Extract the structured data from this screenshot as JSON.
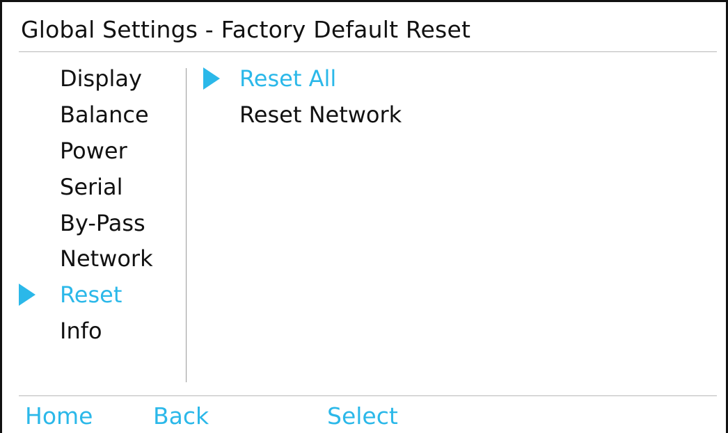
{
  "header": {
    "title": "Global Settings - Factory Default Reset"
  },
  "menu": {
    "items": [
      {
        "label": "Display",
        "selected": false
      },
      {
        "label": "Balance",
        "selected": false
      },
      {
        "label": "Power",
        "selected": false
      },
      {
        "label": "Serial",
        "selected": false
      },
      {
        "label": "By-Pass",
        "selected": false
      },
      {
        "label": "Network",
        "selected": false
      },
      {
        "label": "Reset",
        "selected": true
      },
      {
        "label": "Info",
        "selected": false
      }
    ]
  },
  "submenu": {
    "items": [
      {
        "label": "Reset All",
        "selected": true
      },
      {
        "label": "Reset Network",
        "selected": false
      }
    ]
  },
  "softkeys": {
    "home": "Home",
    "back": "Back",
    "select": "Select"
  },
  "colors": {
    "accent": "#2bb8e9",
    "text": "#111111",
    "rule": "#b8b8b8"
  },
  "icons": {
    "selection_marker": "triangle-right-icon"
  }
}
